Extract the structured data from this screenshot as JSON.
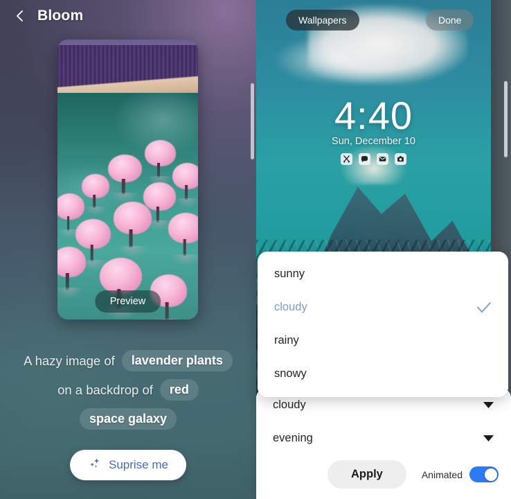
{
  "left_panel": {
    "back_icon": "chevron-left-icon",
    "title": "Bloom",
    "preview_button": "Preview",
    "prompt": {
      "line1_text": "A hazy image of",
      "line1_chip": "lavender plants",
      "line2_text": "on a backdrop of",
      "line2_chip": "red",
      "line3_chip": "space galaxy"
    },
    "surprise_button": {
      "label": "Suprise me",
      "icon": "sparkle-icon",
      "accent_color": "#3f6ccf"
    }
  },
  "right_panel": {
    "wallpapers_pill": "Wallpapers",
    "done_pill": "Done",
    "lock_screen": {
      "time": "4:40",
      "date": "Sun, December 10",
      "notification_icons": [
        "scissors-icon",
        "chat-bubble-icon",
        "mail-icon",
        "camera-icon"
      ]
    },
    "dropdown": {
      "options": [
        {
          "label": "sunny",
          "selected": false
        },
        {
          "label": "cloudy",
          "selected": true
        },
        {
          "label": "rainy",
          "selected": false
        },
        {
          "label": "snowy",
          "selected": false
        }
      ],
      "selected_color": "#7b9bd0",
      "check_icon": "check-icon"
    },
    "sheet": {
      "weather_row": {
        "value": "cloudy",
        "icon": "caret-down-icon"
      },
      "time_row": {
        "value": "evening",
        "icon": "caret-down-icon"
      },
      "apply_button": "Apply",
      "animated_label": "Animated",
      "animated_on": true,
      "toggle_color": "#2b7cf0"
    }
  }
}
